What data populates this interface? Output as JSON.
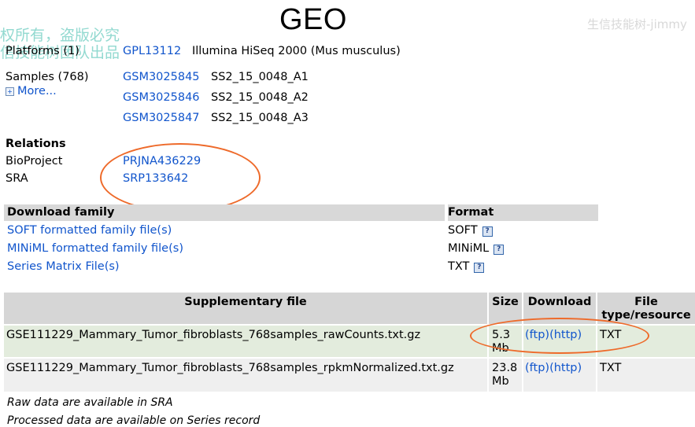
{
  "header": {
    "title": "GEO",
    "watermark_left": [
      "权所有，盗版必究",
      "信技能树团队出品"
    ],
    "watermark_right": "生信技能树-jimmy"
  },
  "platforms": {
    "label": "Platforms (1)",
    "items": [
      {
        "id": "GPL13112",
        "desc": "Illumina HiSeq 2000 (Mus musculus)"
      }
    ]
  },
  "samples": {
    "label": "Samples (768)",
    "more": "More...",
    "items": [
      {
        "id": "GSM3025845",
        "desc": "SS2_15_0048_A1"
      },
      {
        "id": "GSM3025846",
        "desc": "SS2_15_0048_A2"
      },
      {
        "id": "GSM3025847",
        "desc": "SS2_15_0048_A3"
      }
    ]
  },
  "relations": {
    "heading": "Relations",
    "bioproject_label": "BioProject",
    "bioproject_value": "PRJNA436229",
    "sra_label": "SRA",
    "sra_value": "SRP133642"
  },
  "download_family": {
    "col_family": "Download family",
    "col_format": "Format",
    "help_glyph": "?",
    "rows": [
      {
        "name": "SOFT formatted family file(s)",
        "format": "SOFT"
      },
      {
        "name": "MINiML formatted family file(s)",
        "format": "MINiML"
      },
      {
        "name": "Series Matrix File(s)",
        "format": "TXT"
      }
    ]
  },
  "supplementary": {
    "col_file": "Supplementary file",
    "col_size": "Size",
    "col_download": "Download",
    "col_type": "File type/resource",
    "rows": [
      {
        "file": "GSE111229_Mammary_Tumor_fibroblasts_768samples_rawCounts.txt.gz",
        "size": "5.3 Mb",
        "ftp": "(ftp)",
        "http": "(http)",
        "type": "TXT"
      },
      {
        "file": "GSE111229_Mammary_Tumor_fibroblasts_768samples_rpkmNormalized.txt.gz",
        "size": "23.8 Mb",
        "ftp": "(ftp)",
        "http": "(http)",
        "type": "TXT"
      }
    ]
  },
  "notes": {
    "raw": "Raw data are available in SRA",
    "processed": "Processed data are available on Series record"
  },
  "annotation_color": "#ee6a2a"
}
